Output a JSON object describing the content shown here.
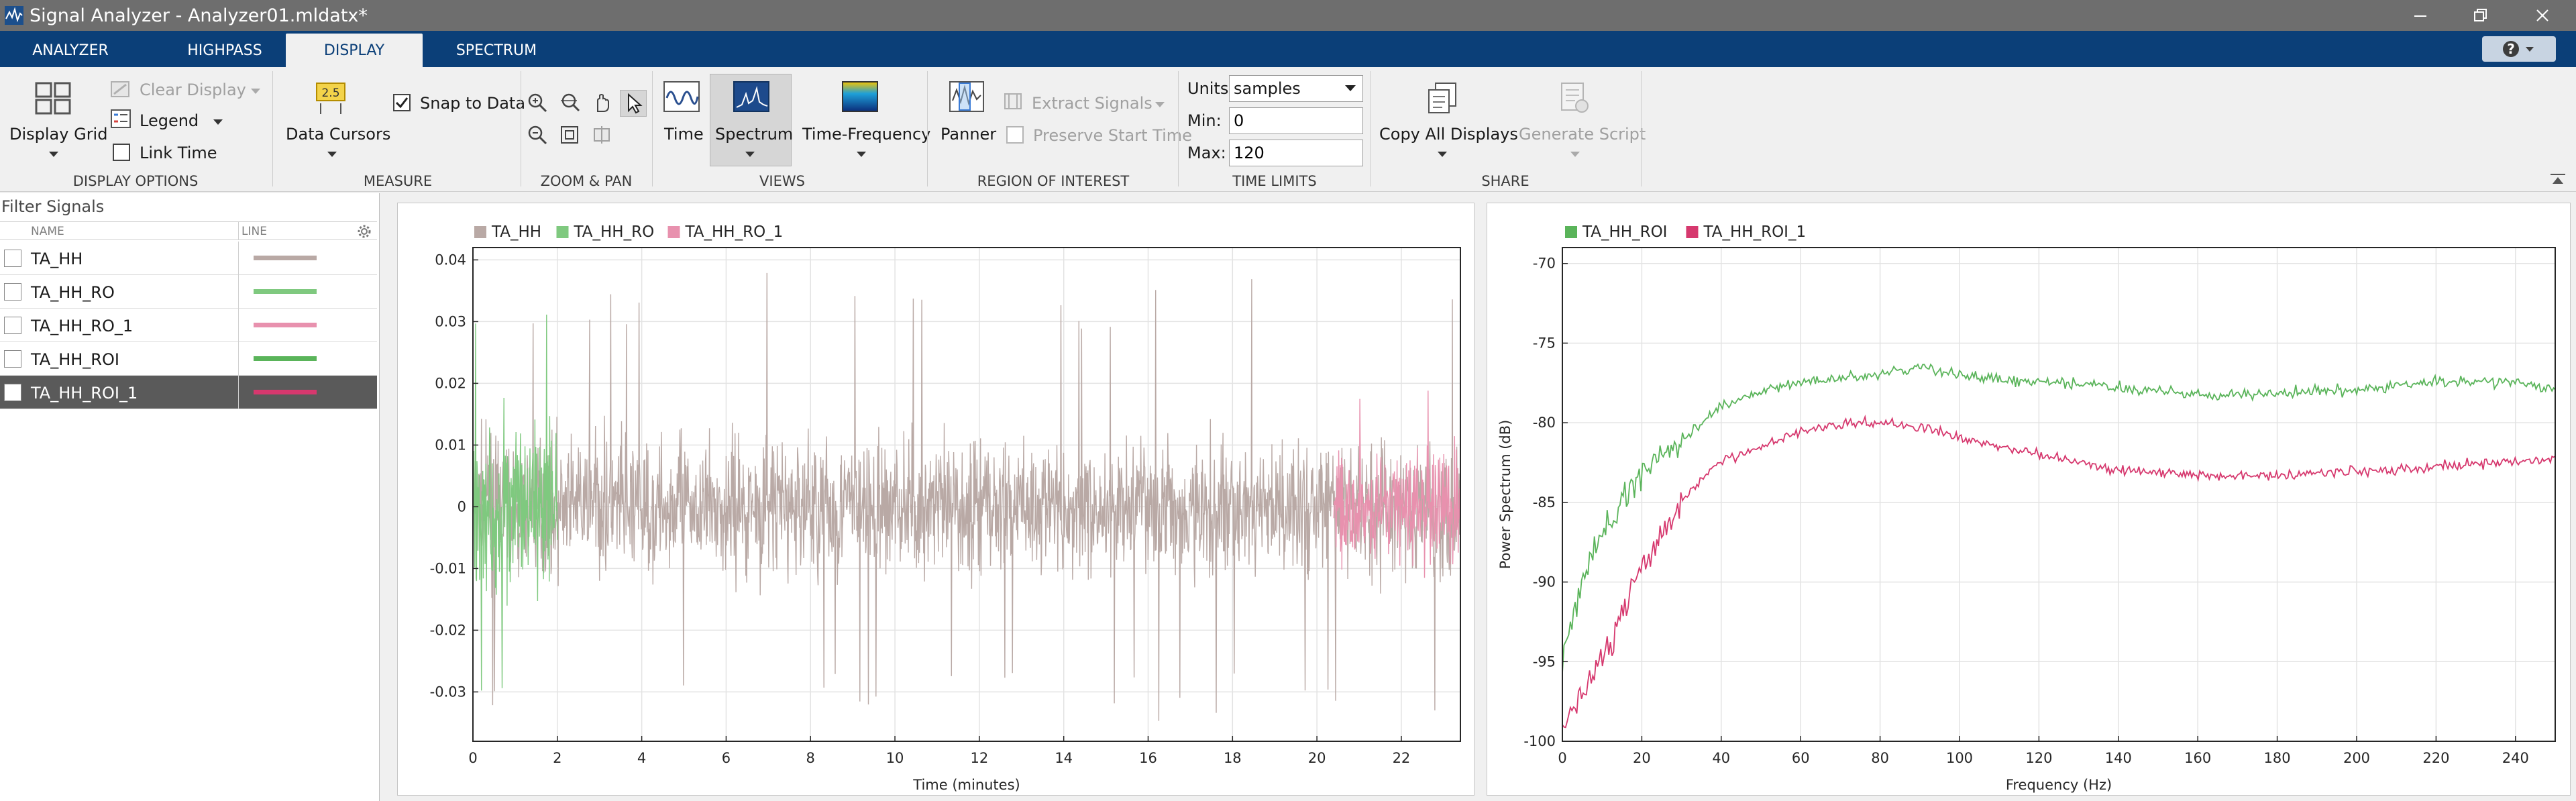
{
  "window": {
    "title": "Signal Analyzer - Analyzer01.mldatx*"
  },
  "tabs": [
    {
      "label": "ANALYZER",
      "active": false
    },
    {
      "label": "HIGHPASS",
      "active": false
    },
    {
      "label": "DISPLAY",
      "active": true
    },
    {
      "label": "SPECTRUM",
      "active": false
    }
  ],
  "toolstrip": {
    "display_options": {
      "label": "DISPLAY OPTIONS",
      "display_grid": "Display Grid",
      "clear_display": "Clear Display",
      "legend": "Legend",
      "link_time": "Link Time"
    },
    "measure": {
      "label": "MEASURE",
      "data_cursors": "Data Cursors",
      "snap_to_data": "Snap to Data",
      "snap_checked": true,
      "cursor_icon_text": "2.5"
    },
    "zoom_pan": {
      "label": "ZOOM & PAN"
    },
    "views": {
      "label": "VIEWS",
      "time": "Time",
      "spectrum": "Spectrum",
      "time_frequency": "Time-Frequency"
    },
    "roi": {
      "label": "REGION OF INTEREST",
      "panner": "Panner",
      "extract_signals": "Extract Signals",
      "preserve_start_time": "Preserve Start Time"
    },
    "time_limits": {
      "label": "TIME LIMITS",
      "units_label": "Units:",
      "units_value": "samples",
      "min_label": "Min:",
      "min_value": "0",
      "max_label": "Max:",
      "max_value": "120"
    },
    "share": {
      "label": "SHARE",
      "copy_all_displays": "Copy All Displays",
      "generate_script": "Generate Script"
    }
  },
  "signal_panel": {
    "filter_label": "Filter Signals",
    "columns": [
      "NAME",
      "LINE"
    ],
    "signals": [
      {
        "name": "TA_HH",
        "color": "#b9a9a5",
        "selected": false
      },
      {
        "name": "TA_HH_RO",
        "color": "#7fc97f",
        "selected": false
      },
      {
        "name": "TA_HH_RO_1",
        "color": "#e891ae",
        "selected": false
      },
      {
        "name": "TA_HH_ROI",
        "color": "#5ab45a",
        "selected": false
      },
      {
        "name": "TA_HH_ROI_1",
        "color": "#d6386e",
        "selected": true
      }
    ]
  },
  "chart_data": [
    {
      "type": "line",
      "xlabel": "Time (minutes)",
      "ylabel": "",
      "xlim": [
        0,
        23.4
      ],
      "ylim": [
        -0.038,
        0.042
      ],
      "xticks": [
        0,
        2,
        4,
        6,
        8,
        10,
        12,
        14,
        16,
        18,
        20,
        22
      ],
      "yticks": [
        -0.03,
        -0.02,
        -0.01,
        0,
        0.01,
        0.02,
        0.03,
        0.04
      ],
      "ytick_labels": [
        "-0.03",
        "-0.02",
        "-0.01",
        "0",
        "0.01",
        "0.02",
        "0.03",
        "0.04"
      ],
      "grid": true,
      "legend_position": "top-left",
      "series": [
        {
          "name": "TA_HH",
          "color": "#b9a9a5",
          "x_range": [
            0,
            23.4
          ],
          "amplitude": 0.02,
          "peak": 0.038,
          "trough": -0.035
        },
        {
          "name": "TA_HH_RO",
          "color": "#7fc97f",
          "x_range": [
            0,
            2.0
          ],
          "amplitude": 0.024,
          "peak": 0.039,
          "trough": -0.03
        },
        {
          "name": "TA_HH_RO_1",
          "color": "#e891ae",
          "x_range": [
            20.4,
            23.4
          ],
          "amplitude": 0.017,
          "peak": 0.022,
          "trough": -0.028
        }
      ]
    },
    {
      "type": "line",
      "xlabel": "Frequency (Hz)",
      "ylabel": "Power Spectrum (dB)",
      "xlim": [
        0,
        250
      ],
      "ylim": [
        -100,
        -69
      ],
      "xticks": [
        0,
        20,
        40,
        60,
        80,
        100,
        120,
        140,
        160,
        180,
        200,
        220,
        240
      ],
      "yticks": [
        -100,
        -95,
        -90,
        -85,
        -80,
        -75,
        -70
      ],
      "grid": true,
      "legend_position": "top-left",
      "series": [
        {
          "name": "TA_HH_ROI",
          "color": "#5ab45a",
          "x": [
            0,
            5,
            10,
            15,
            20,
            25,
            30,
            35,
            40,
            50,
            60,
            70,
            80,
            90,
            100,
            110,
            120,
            130,
            140,
            150,
            160,
            170,
            180,
            190,
            200,
            210,
            220,
            230,
            240,
            250
          ],
          "y": [
            -95,
            -90,
            -87,
            -85,
            -83,
            -82,
            -81,
            -80,
            -79,
            -78,
            -77.5,
            -77.2,
            -77,
            -76.5,
            -77,
            -77.3,
            -77.5,
            -77.5,
            -77.8,
            -78,
            -78.3,
            -78.2,
            -78.2,
            -78,
            -78,
            -77.7,
            -77.4,
            -77.4,
            -77.5,
            -77.9
          ]
        },
        {
          "name": "TA_HH_ROI_1",
          "color": "#d6386e",
          "x": [
            0,
            5,
            10,
            15,
            20,
            25,
            30,
            35,
            40,
            50,
            60,
            70,
            80,
            90,
            100,
            110,
            120,
            130,
            140,
            150,
            160,
            170,
            180,
            190,
            200,
            210,
            220,
            230,
            240,
            250
          ],
          "y": [
            -99,
            -97,
            -95,
            -92,
            -89,
            -87,
            -85,
            -83.5,
            -82.5,
            -81.5,
            -80.5,
            -80,
            -80,
            -80.2,
            -81,
            -81.5,
            -82,
            -82.5,
            -83,
            -83,
            -83.3,
            -83.3,
            -83.3,
            -83.2,
            -83,
            -83,
            -82.8,
            -82.5,
            -82.5,
            -82.3
          ]
        }
      ]
    }
  ]
}
